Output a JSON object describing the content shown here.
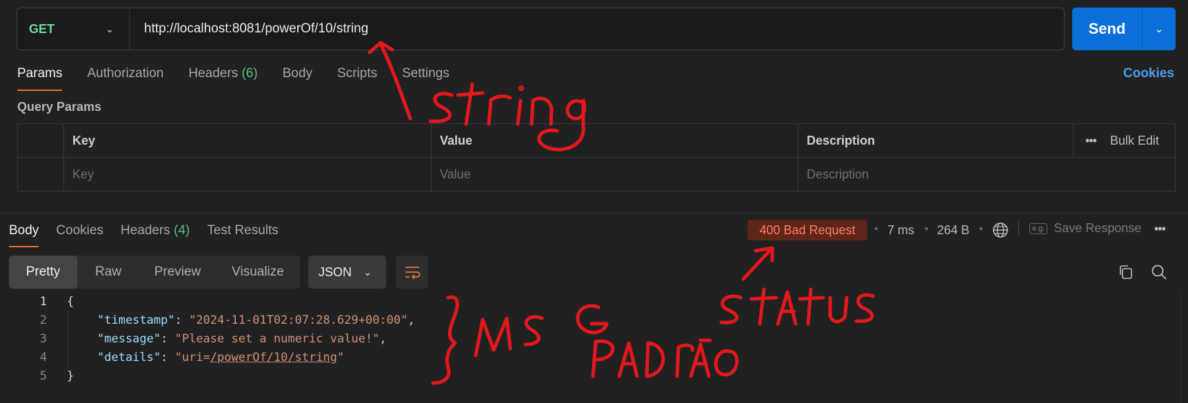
{
  "request": {
    "method": "GET",
    "url": "http://localhost:8081/powerOf/10/string",
    "send_label": "Send"
  },
  "request_tabs": {
    "params": "Params",
    "authorization": "Authorization",
    "headers": "Headers",
    "headers_count": "(6)",
    "body": "Body",
    "scripts": "Scripts",
    "settings": "Settings",
    "cookies": "Cookies"
  },
  "query_params": {
    "title": "Query Params",
    "columns": {
      "key": "Key",
      "value": "Value",
      "description": "Description"
    },
    "bulk_edit": "Bulk Edit",
    "placeholders": {
      "key": "Key",
      "value": "Value",
      "description": "Description"
    }
  },
  "response_tabs": {
    "body": "Body",
    "cookies": "Cookies",
    "headers": "Headers",
    "headers_count": "(4)",
    "test_results": "Test Results"
  },
  "response_meta": {
    "status": "400 Bad Request",
    "time": "7 ms",
    "size": "264 B",
    "save_response": "Save Response",
    "save_icon_text": "e.g."
  },
  "view": {
    "modes": [
      "Pretty",
      "Raw",
      "Preview",
      "Visualize"
    ],
    "format": "JSON"
  },
  "code": {
    "line_numbers": [
      "1",
      "2",
      "3",
      "4",
      "5"
    ],
    "open_brace": "{",
    "close_brace": "}",
    "timestamp_key": "\"timestamp\"",
    "timestamp_value": "\"2024-11-01T02:07:28.629+00:00\"",
    "message_key": "\"message\"",
    "message_value": "\"Please set a numeric value!\"",
    "details_key": "\"details\"",
    "details_prefix": "\"uri=",
    "details_link": "/powerOf/10/string",
    "details_suffix": "\""
  },
  "colors": {
    "accent_tab": "#f26b3a",
    "send_blue": "#0b6fd9",
    "status_error_bg": "#5e2519",
    "status_error_text": "#ff7f66",
    "method_green": "#6bdd9a",
    "annotation_red": "#e3181c"
  }
}
